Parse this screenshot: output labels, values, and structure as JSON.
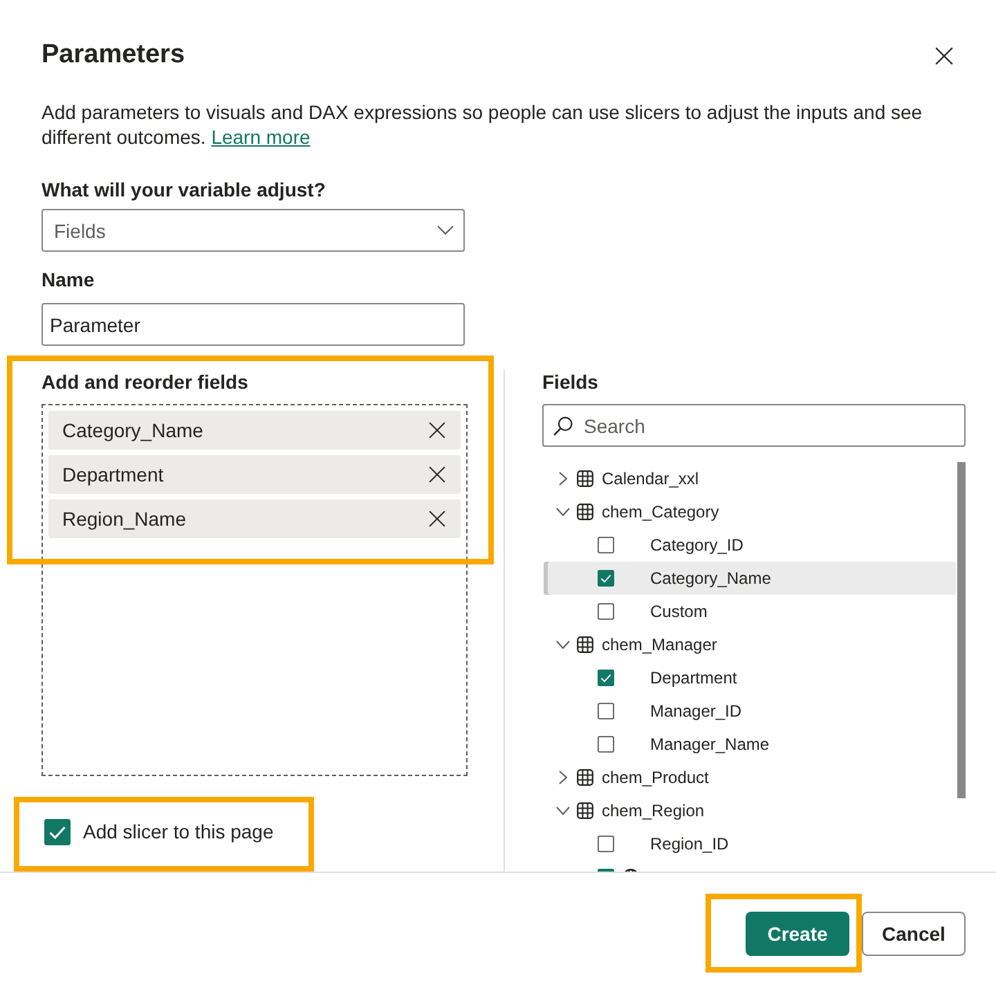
{
  "dialog": {
    "title": "Parameters",
    "description": "Add parameters to visuals and DAX expressions so people can use slicers to adjust the inputs and see different outcomes.",
    "link": "Learn more"
  },
  "adjust": {
    "label": "What will your variable adjust?",
    "value": "Fields"
  },
  "name": {
    "label": "Name",
    "value": "Parameter"
  },
  "reorder": {
    "label": "Add and reorder fields",
    "highlighted": true,
    "chips": [
      "Category_Name",
      "Department",
      "Region_Name"
    ]
  },
  "fields": {
    "label": "Fields",
    "search": {
      "placeholder": "Search"
    },
    "tables": [
      {
        "label": "Calendar_xxl",
        "expanded": false
      },
      {
        "label": "chem_Category",
        "expanded": true,
        "children": [
          {
            "label": "Category_ID",
            "kind": "column",
            "checked": false,
            "selected": false
          },
          {
            "label": "Category_Name",
            "kind": "column",
            "checked": true,
            "selected": true
          },
          {
            "label": "Custom",
            "kind": "column",
            "checked": false,
            "selected": false
          }
        ]
      },
      {
        "label": "chem_Manager",
        "expanded": true,
        "children": [
          {
            "label": "Department",
            "kind": "column",
            "checked": true,
            "selected": false
          },
          {
            "label": "Manager_ID",
            "kind": "column",
            "checked": false,
            "selected": false
          },
          {
            "label": "Manager_Name",
            "kind": "column",
            "checked": false,
            "selected": false
          }
        ]
      },
      {
        "label": "chem_Product",
        "expanded": false
      },
      {
        "label": "chem_Region",
        "expanded": true,
        "children": [
          {
            "label": "Region_ID",
            "kind": "column",
            "checked": false,
            "selected": false
          },
          {
            "kind": "geo",
            "checked": true,
            "selected": false
          }
        ]
      }
    ]
  },
  "slicer": {
    "label": "Add slicer to this page",
    "checked": true,
    "highlighted": true
  },
  "buttons": [
    {
      "label": "Create",
      "kind": "primary",
      "highlighted": true
    },
    {
      "label": "Cancel",
      "kind": "secondary",
      "highlighted": false
    }
  ]
}
